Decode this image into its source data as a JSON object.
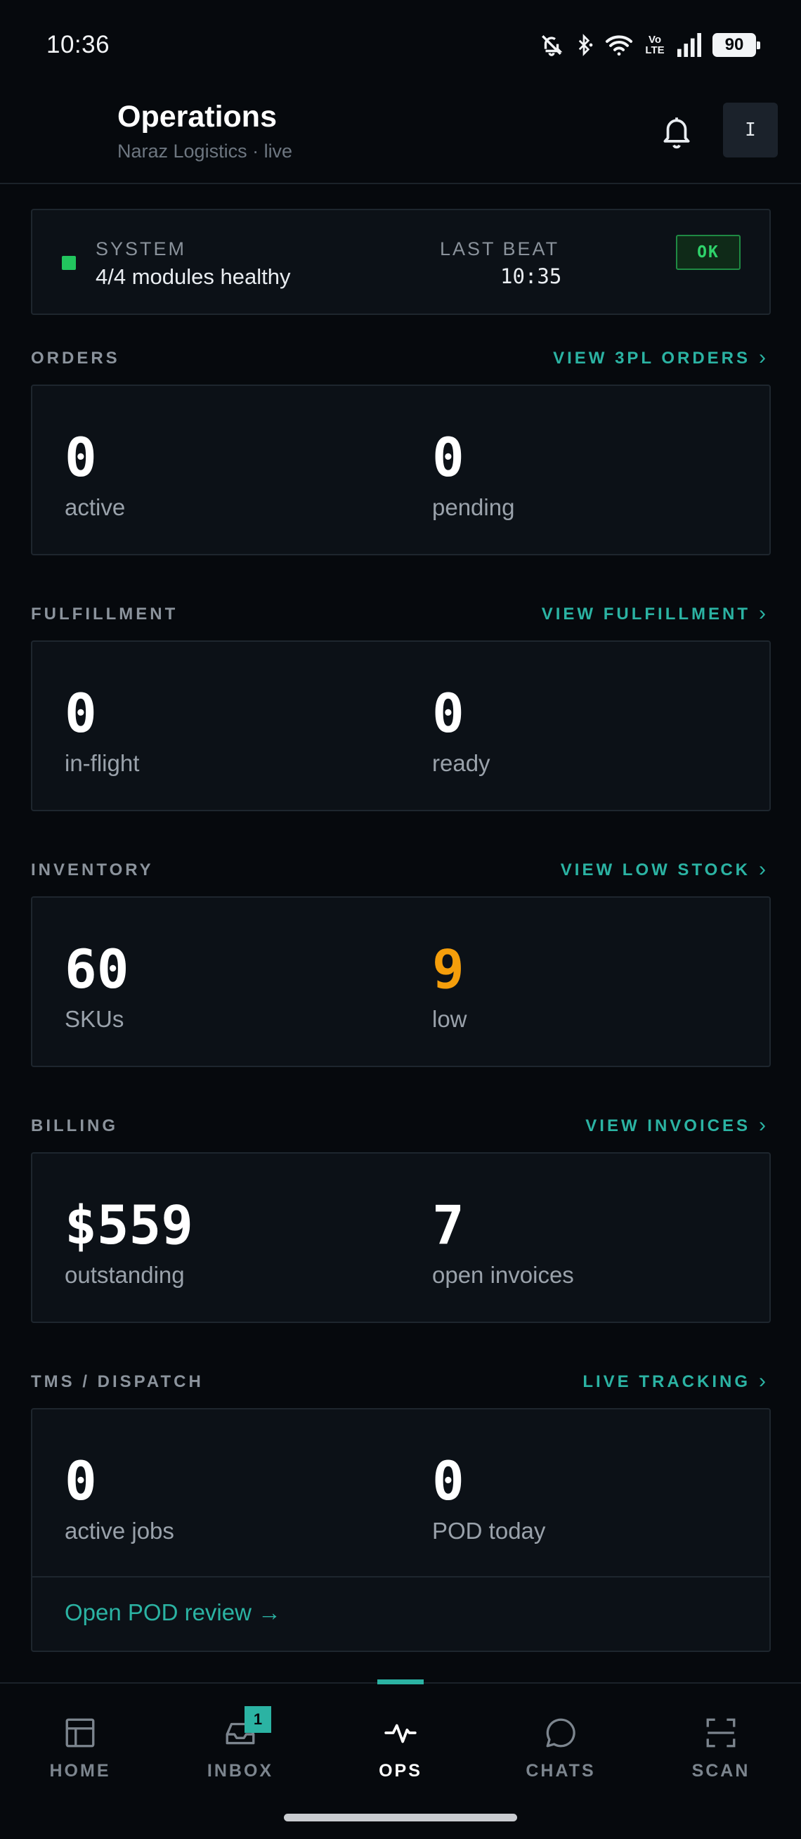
{
  "status_bar": {
    "time": "10:36",
    "battery": "90",
    "network_label": "Vo LTE",
    "icons": [
      "mute-bell-icon",
      "bluetooth-icon",
      "wifi-icon",
      "volte-icon",
      "signal-icon",
      "battery-icon"
    ]
  },
  "header": {
    "title": "Operations",
    "subtitle": "Naraz Logistics · live",
    "avatar_initial": "I",
    "icons": [
      "bell-icon"
    ]
  },
  "system": {
    "label": "SYSTEM",
    "status": "4/4 modules healthy",
    "last_beat_label": "LAST BEAT",
    "last_beat_time": "10:35",
    "badge": "OK",
    "dot_color": "#22c55e"
  },
  "sections": {
    "orders": {
      "title": "ORDERS",
      "link": "VIEW 3PL ORDERS",
      "stats": [
        {
          "value": "0",
          "label": "active"
        },
        {
          "value": "0",
          "label": "pending"
        }
      ]
    },
    "fulfillment": {
      "title": "FULFILLMENT",
      "link": "VIEW FULFILLMENT",
      "stats": [
        {
          "value": "0",
          "label": "in-flight"
        },
        {
          "value": "0",
          "label": "ready"
        }
      ]
    },
    "inventory": {
      "title": "INVENTORY",
      "link": "VIEW LOW STOCK",
      "stats": [
        {
          "value": "60",
          "label": "SKUs"
        },
        {
          "value": "9",
          "label": "low"
        }
      ]
    },
    "billing": {
      "title": "BILLING",
      "link": "VIEW INVOICES",
      "stats": [
        {
          "value": "$559",
          "label": "outstanding"
        },
        {
          "value": "7",
          "label": "open invoices"
        }
      ]
    },
    "tms": {
      "title": "TMS / DISPATCH",
      "link": "LIVE TRACKING",
      "stats": [
        {
          "value": "0",
          "label": "active jobs"
        },
        {
          "value": "0",
          "label": "POD today"
        }
      ],
      "pod_link": "Open POD review →"
    }
  },
  "nav": {
    "tabs": [
      {
        "label": "HOME",
        "icon": "home-grid-icon"
      },
      {
        "label": "INBOX",
        "icon": "inbox-tray-icon",
        "badge": "1"
      },
      {
        "label": "OPS",
        "icon": "pulse-icon",
        "active": true
      },
      {
        "label": "CHATS",
        "icon": "chat-bubble-icon"
      },
      {
        "label": "SCAN",
        "icon": "scan-frame-icon"
      }
    ]
  },
  "colors": {
    "background": "#06090d",
    "card": "#0c1117",
    "accent": "#2bb3a3",
    "ok": "#22c55e",
    "warning": "#f59e0b"
  }
}
